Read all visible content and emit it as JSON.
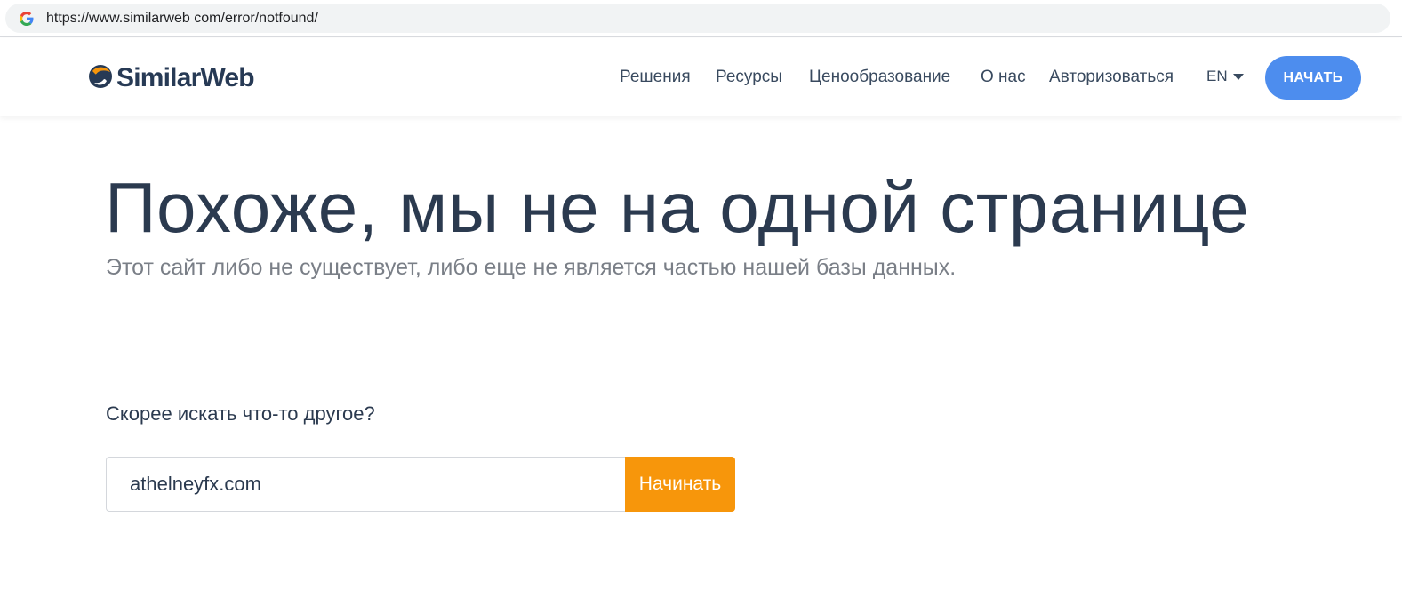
{
  "browser": {
    "url": "https://www.similarweb com/error/notfound/",
    "favicon_icon": "google-g-icon"
  },
  "header": {
    "logo_text": "SimilarWeb",
    "logo_icon": "similarweb-logo-icon",
    "nav": [
      "Решения",
      "Ресурсы",
      "Ценообразование",
      "О нас",
      "Авторизоваться"
    ],
    "language": "EN",
    "cta_label": "НАЧАТЬ",
    "cta_color": "#4d8dee"
  },
  "main": {
    "headline": "Похоже, мы не на одной странице",
    "subline": "Этот сайт либо не существует, либо еще не является частью нашей базы данных.",
    "prompt": "Скорее искать что-то другое?",
    "search_value": "athelneyfx.com",
    "search_button": "Начинать",
    "search_button_color": "#f7960b"
  }
}
